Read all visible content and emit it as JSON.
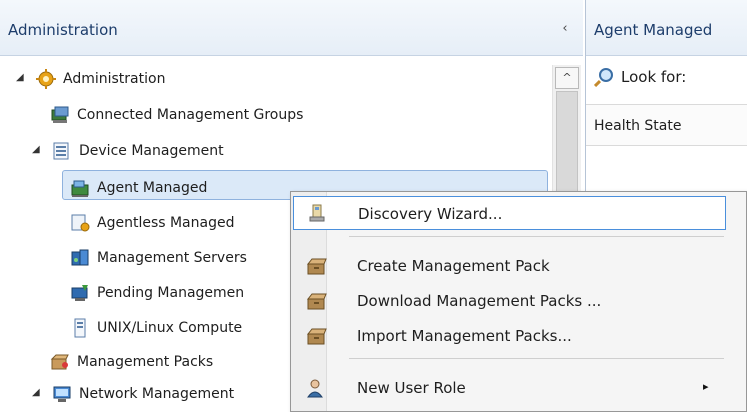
{
  "nav": {
    "title": "Administration",
    "collapse_glyph": "‹",
    "tree": [
      {
        "label": "Administration",
        "icon": "gear-icon",
        "expander": "◢"
      },
      {
        "label": "Connected Management Groups",
        "icon": "server-group-icon"
      },
      {
        "label": "Device Management",
        "icon": "device-folder-icon",
        "expander": "◢"
      },
      {
        "label": "Agent Managed",
        "icon": "agent-managed-icon"
      },
      {
        "label": "Agentless Managed",
        "icon": "agentless-managed-icon"
      },
      {
        "label": "Management Servers",
        "icon": "management-servers-icon"
      },
      {
        "label": "Pending Managemen",
        "icon": "pending-management-icon"
      },
      {
        "label": "UNIX/Linux Compute",
        "icon": "unix-linux-icon"
      },
      {
        "label": "Management Packs",
        "icon": "management-packs-icon"
      },
      {
        "label": "Network Management",
        "icon": "network-management-icon",
        "expander": "◢"
      }
    ],
    "scroll_up_glyph": "^"
  },
  "right": {
    "title": "Agent Managed",
    "lookfor_label": "Look for:",
    "column_header": "Health State"
  },
  "context_menu": {
    "items": [
      {
        "label": "Discovery Wizard...",
        "icon": "discovery-wizard-icon",
        "highlighted": true
      },
      {
        "label": "Create Management Pack",
        "icon": "package-icon"
      },
      {
        "label": "Download Management Packs ...",
        "icon": "package-icon"
      },
      {
        "label": "Import Management Packs...",
        "icon": "package-icon"
      },
      {
        "label": "New User Role",
        "icon": "user-role-icon",
        "submenu": "▸"
      }
    ]
  },
  "colors": {
    "header_text": "#1d3d6b",
    "selection_bg": "#dbe9f8",
    "selection_border": "#8fb2de",
    "menu_highlight_border": "#4a8fdc"
  }
}
